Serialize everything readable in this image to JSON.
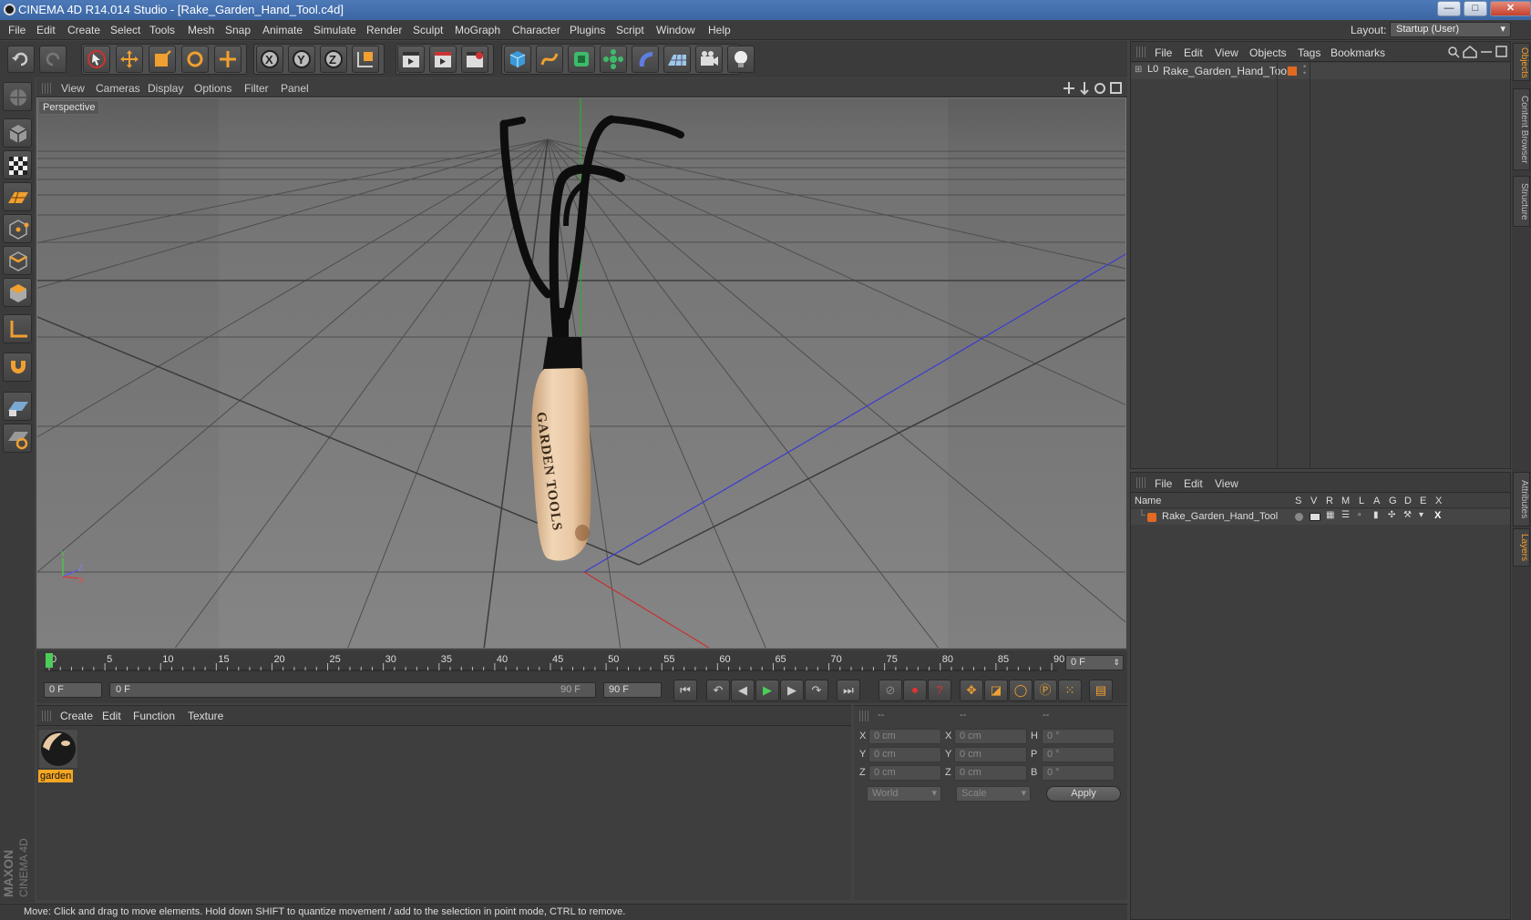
{
  "window": {
    "title": "CINEMA 4D R14.014 Studio - [Rake_Garden_Hand_Tool.c4d]",
    "btn_min": "—",
    "btn_max": "□",
    "btn_close": "✕"
  },
  "menubar": {
    "items": [
      "File",
      "Edit",
      "Create",
      "Select",
      "Tools",
      "Mesh",
      "Snap",
      "Animate",
      "Simulate",
      "Render",
      "Sculpt",
      "MoGraph",
      "Character",
      "Plugins",
      "Script",
      "Window",
      "Help"
    ],
    "layout_label": "Layout:",
    "layout_value": "Startup (User)"
  },
  "viewport": {
    "menu": [
      "View",
      "Cameras",
      "Display",
      "Options",
      "Filter",
      "Panel"
    ],
    "camera_label": "Perspective",
    "handle_text": "GARDEN TOOLS",
    "axis_y": "Y",
    "axis_z": "Z",
    "axis_x": "X"
  },
  "timeline": {
    "ticks": [
      "0",
      "5",
      "10",
      "15",
      "20",
      "25",
      "30",
      "35",
      "40",
      "45",
      "50",
      "55",
      "60",
      "65",
      "70",
      "75",
      "80",
      "85",
      "90"
    ],
    "current_frame": "0 F",
    "start_field": "0 F",
    "range_start": "0 F",
    "range_end": "90 F",
    "end_field": "90 F"
  },
  "material_manager": {
    "menu": [
      "Create",
      "Edit",
      "Function",
      "Texture"
    ],
    "materials": [
      {
        "name": "garden"
      }
    ]
  },
  "coordinates": {
    "headers": [
      "--",
      "--",
      "--"
    ],
    "rows": [
      {
        "a_label": "X",
        "a_val": "0 cm",
        "b_label": "X",
        "b_val": "0 cm",
        "c_label": "H",
        "c_val": "0 °"
      },
      {
        "a_label": "Y",
        "a_val": "0 cm",
        "b_label": "Y",
        "b_val": "0 cm",
        "c_label": "P",
        "c_val": "0 °"
      },
      {
        "a_label": "Z",
        "a_val": "0 cm",
        "b_label": "Z",
        "b_val": "0 cm",
        "c_label": "B",
        "c_val": "0 °"
      }
    ],
    "mode_1": "World",
    "mode_2": "Scale",
    "apply_label": "Apply"
  },
  "object_manager": {
    "menu": [
      "File",
      "Edit",
      "View",
      "Objects",
      "Tags",
      "Bookmarks"
    ],
    "objects": [
      {
        "name": "Rake_Garden_Hand_Tool",
        "icon": "null-object-icon",
        "color": "#e06a20"
      }
    ]
  },
  "layer_manager": {
    "menu": [
      "File",
      "Edit",
      "View"
    ],
    "columns": [
      "Name",
      "S",
      "V",
      "R",
      "M",
      "L",
      "A",
      "G",
      "D",
      "E",
      "X"
    ],
    "layers": [
      {
        "name": "Rake_Garden_Hand_Tool",
        "color": "#e06a20"
      }
    ]
  },
  "side_tabs": [
    "Objects",
    "Content Browser",
    "Structure",
    "Attributes",
    "Layers"
  ],
  "branding": {
    "logo_text": "MAXON",
    "logo_sub": "CINEMA 4D"
  },
  "status": {
    "text": "Move: Click and drag to move elements. Hold down SHIFT to quantize movement / add to the selection in point mode, CTRL to remove."
  },
  "colors": {
    "accent": "#f0a030",
    "selection": "#f5a623",
    "grid_bg": "#6a6a6a"
  }
}
